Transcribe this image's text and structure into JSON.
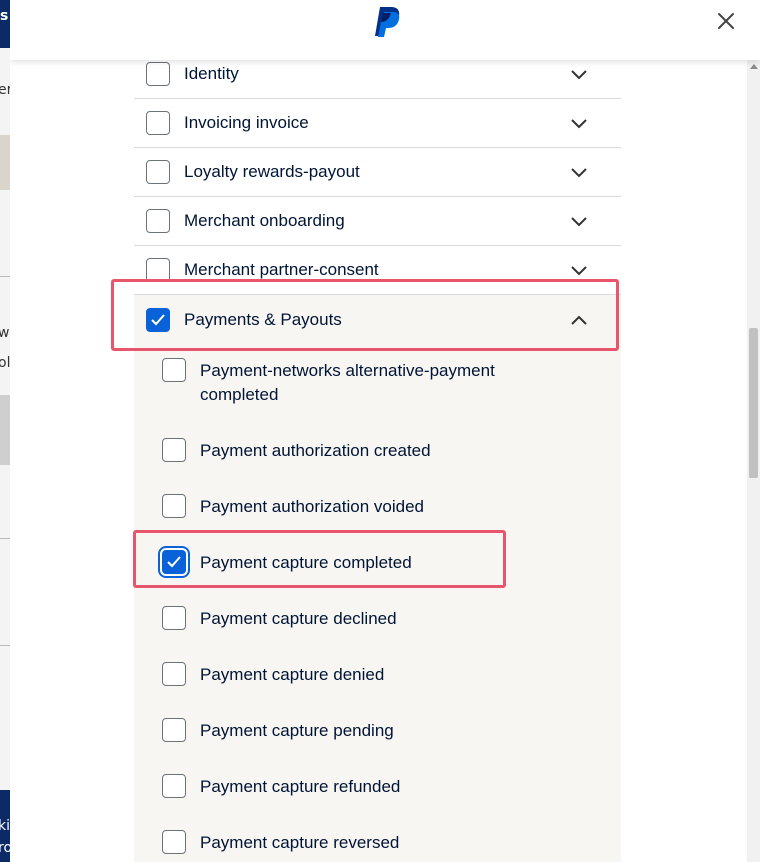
{
  "background_page": {
    "fragments": [
      "s",
      "er",
      "w",
      "ol",
      "ki",
      "ro"
    ]
  },
  "modal": {
    "logo_icon": "paypal-logo-icon",
    "close_icon": "close-icon",
    "categories": [
      {
        "label": "Identity",
        "checked": false,
        "expanded": false
      },
      {
        "label": "Invoicing invoice",
        "checked": false,
        "expanded": false
      },
      {
        "label": "Loyalty rewards-payout",
        "checked": false,
        "expanded": false
      },
      {
        "label": "Merchant onboarding",
        "checked": false,
        "expanded": false
      },
      {
        "label": "Merchant partner-consent",
        "checked": false,
        "expanded": false
      },
      {
        "label": "Payments & Payouts",
        "checked": true,
        "expanded": true
      }
    ],
    "events": [
      {
        "label": "Payment-networks alternative-payment completed",
        "checked": false
      },
      {
        "label": "Payment authorization created",
        "checked": false
      },
      {
        "label": "Payment authorization voided",
        "checked": false
      },
      {
        "label": "Payment capture completed",
        "checked": true
      },
      {
        "label": "Payment capture declined",
        "checked": false
      },
      {
        "label": "Payment capture denied",
        "checked": false
      },
      {
        "label": "Payment capture pending",
        "checked": false
      },
      {
        "label": "Payment capture refunded",
        "checked": false
      },
      {
        "label": "Payment capture reversed",
        "checked": false
      }
    ]
  },
  "colors": {
    "accent": "#0a62d9",
    "highlight": "#e8566b",
    "expanded_bg": "#f8f6f3",
    "text": "#001435"
  }
}
